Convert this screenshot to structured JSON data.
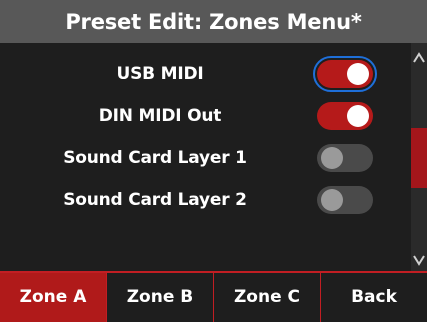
{
  "header": {
    "title": "Preset Edit: Zones Menu*"
  },
  "settings": [
    {
      "label": "USB MIDI",
      "state": "on",
      "focused": true
    },
    {
      "label": "DIN MIDI Out",
      "state": "on",
      "focused": false
    },
    {
      "label": "Sound Card Layer 1",
      "state": "off",
      "focused": false
    },
    {
      "label": "Sound Card Layer 2",
      "state": "off",
      "focused": false
    }
  ],
  "scroll": {
    "up_glyph": "^",
    "down_glyph": "v"
  },
  "footer": {
    "tabs": [
      {
        "label": "Zone A",
        "active": true
      },
      {
        "label": "Zone B",
        "active": false
      },
      {
        "label": "Zone C",
        "active": false
      },
      {
        "label": "Back",
        "active": false
      }
    ]
  },
  "colors": {
    "accent": "#b51a1a",
    "header_bg": "#585858",
    "background": "#1e1e1e"
  }
}
